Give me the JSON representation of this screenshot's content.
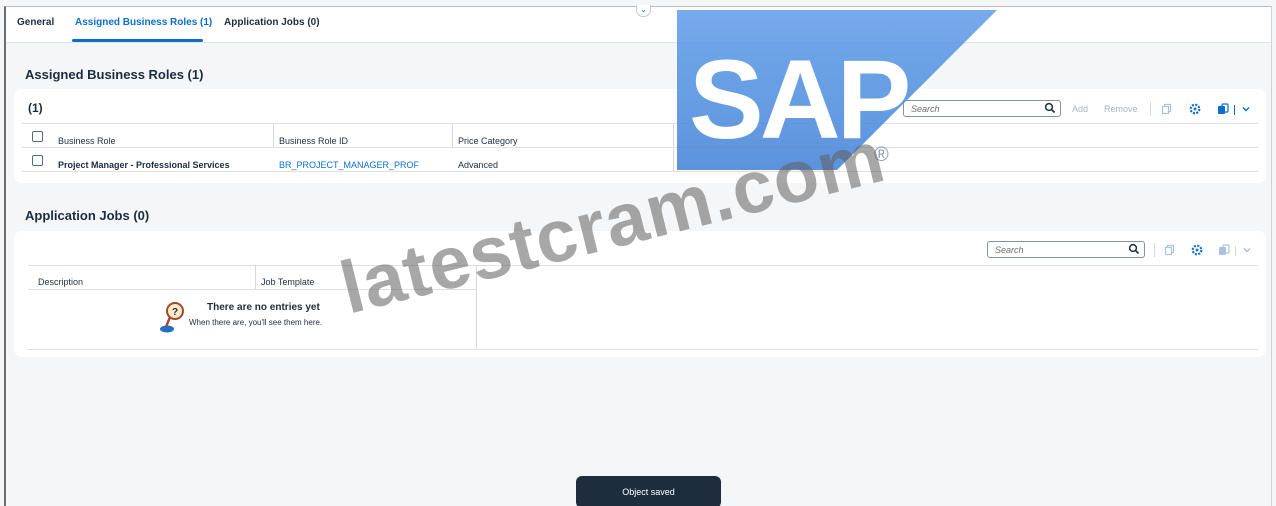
{
  "tabs": [
    {
      "label": "General"
    },
    {
      "label": "Assigned Business Roles (1)"
    },
    {
      "label": "Application Jobs (0)"
    }
  ],
  "roles_section": {
    "title": "Assigned Business Roles (1)",
    "count": "(1)",
    "search_placeholder": "Search",
    "add_label": "Add",
    "remove_label": "Remove",
    "columns": [
      "Business Role",
      "Business Role ID",
      "Price Category"
    ],
    "rows": [
      {
        "role": "Project Manager - Professional Services",
        "id": "BR_PROJECT_MANAGER_PROF",
        "price": "Advanced"
      }
    ]
  },
  "jobs_section": {
    "title": "Application Jobs (0)",
    "search_placeholder": "Search",
    "columns": [
      "Description",
      "Job Template"
    ],
    "empty_title": "There are no entries yet",
    "empty_sub": "When there are, you'll see them here."
  },
  "toast": "Object saved",
  "logo": "SAP",
  "logo_mark": "®",
  "watermark": "latestcram.com",
  "colors": {
    "accent": "#0a6ed1",
    "text": "#1d2d3e",
    "toast_bg": "#1d2d3e",
    "logo_blue": "#4f8fe0"
  }
}
